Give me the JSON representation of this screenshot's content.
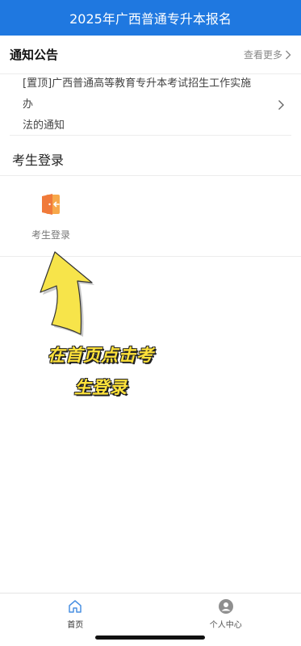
{
  "header": {
    "title": "2025年广西普通专升本报名"
  },
  "notices": {
    "title": "通知公告",
    "more_label": "查看更多",
    "items": [
      {
        "line1": "[置顶]广西普通高等教育专升本考试招生工作实施办",
        "line2": "法的通知"
      }
    ]
  },
  "login_section": {
    "title": "考生登录",
    "button_label": "考生登录"
  },
  "annotation": {
    "line1": "在首页点击考",
    "line2": "生登录"
  },
  "tabbar": {
    "items": [
      {
        "label": "首页",
        "icon": "home-icon",
        "active": true
      },
      {
        "label": "个人中心",
        "icon": "user-center-icon",
        "active": false
      }
    ]
  },
  "colors": {
    "header_bg": "#1f78e0",
    "annotation_fill": "#ffe23a",
    "login_icon_orange": "#f07a3a",
    "tab_active": "#4a90e2"
  }
}
